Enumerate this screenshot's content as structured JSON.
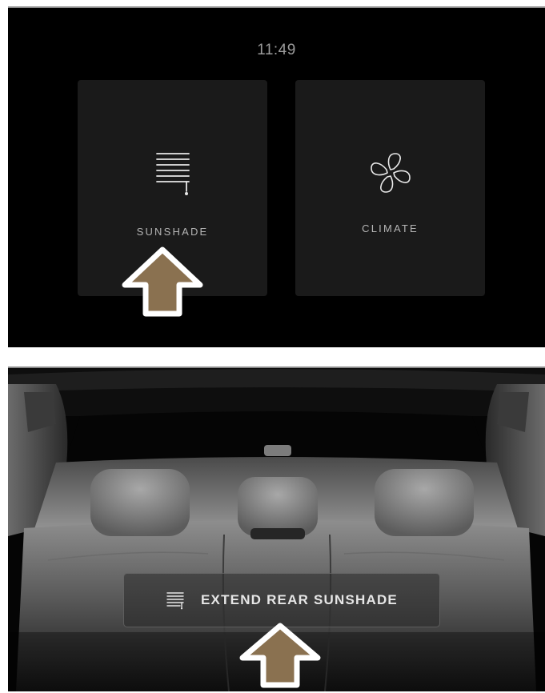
{
  "status_bar": {
    "time": "11:49"
  },
  "tiles": [
    {
      "label": "SUNSHADE",
      "icon": "sunshade-icon"
    },
    {
      "label": "CLIMATE",
      "icon": "fan-icon"
    }
  ],
  "rear_view": {
    "button_label": "EXTEND REAR SUNSHADE",
    "button_icon": "sunshade-icon"
  },
  "annotations": {
    "arrow_color": "#8a7150",
    "arrow_outline": "#ffffff"
  }
}
